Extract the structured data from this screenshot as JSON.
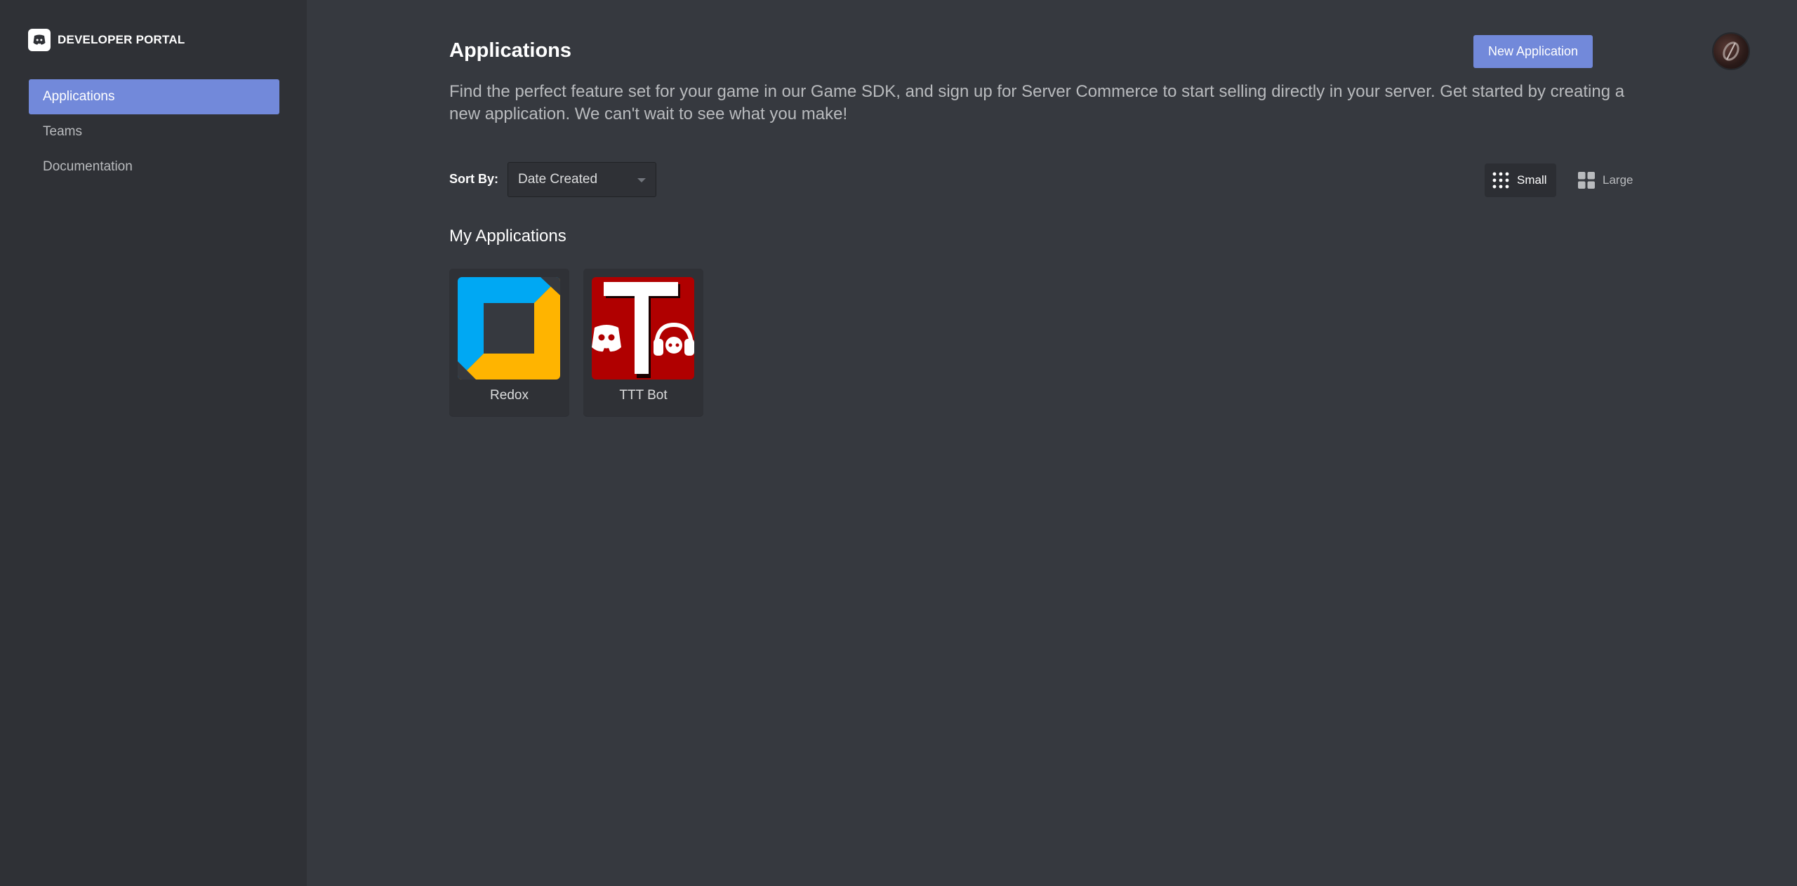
{
  "brand": {
    "title": "DEVELOPER PORTAL",
    "icon": "discord-logo-icon"
  },
  "sidebar": {
    "items": [
      {
        "label": "Applications",
        "active": true
      },
      {
        "label": "Teams",
        "active": false
      },
      {
        "label": "Documentation",
        "active": false
      }
    ]
  },
  "header": {
    "title": "Applications",
    "new_button": "New Application",
    "avatar": "user-avatar"
  },
  "description": "Find the perfect feature set for your game in our Game SDK, and sign up for Server Commerce to start selling directly in your server. Get started by creating a new application. We can't wait to see what you make!",
  "sort": {
    "label": "Sort By:",
    "value": "Date Created"
  },
  "view": {
    "small_label": "Small",
    "large_label": "Large",
    "selected": "Small"
  },
  "section": {
    "title": "My Applications"
  },
  "apps": [
    {
      "name": "Redox",
      "icon": "redox-app-icon"
    },
    {
      "name": "TTT Bot",
      "icon": "ttt-bot-app-icon"
    }
  ],
  "colors": {
    "accent": "#7289da",
    "sidebar_bg": "#2f3136",
    "main_bg": "#36393f",
    "redox_blue": "#00a8f3",
    "redox_yellow": "#ffb400",
    "ttt_red": "#b00000"
  }
}
